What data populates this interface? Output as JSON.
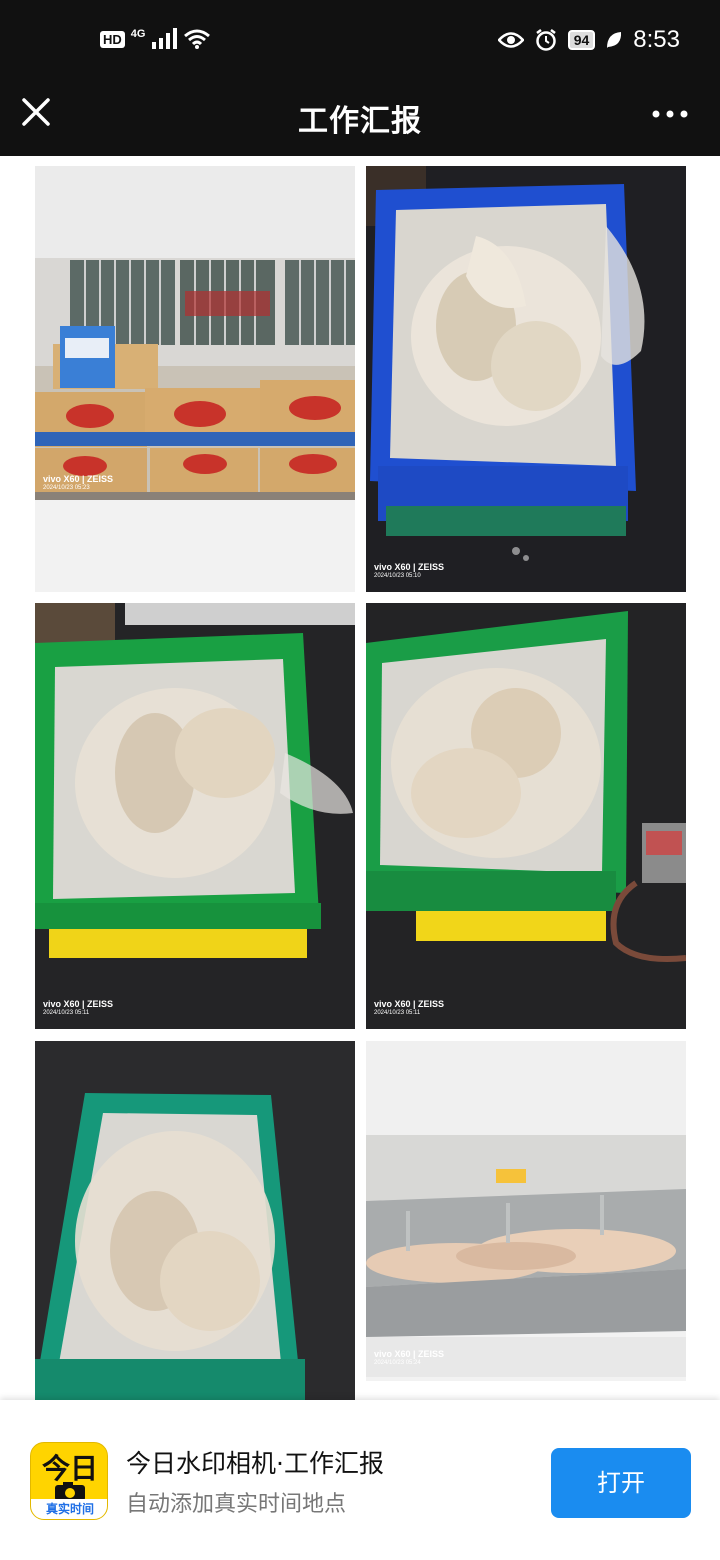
{
  "status_bar": {
    "hd": "HD",
    "network": "4G",
    "battery": "94",
    "time": "8:53",
    "icons": [
      "signal-icon",
      "wifi-icon",
      "eye-icon",
      "alarm-icon",
      "battery-icon",
      "leaf-icon"
    ]
  },
  "nav": {
    "title": "工作汇报",
    "close_icon": "close-icon",
    "more_icon": "more-icon"
  },
  "photos": [
    {
      "camera": "vivo X60 | ZEISS",
      "date": "2024/10/23 05:23",
      "subject": "boxes"
    },
    {
      "camera": "vivo X60 | ZEISS",
      "date": "2024/10/23 05:10",
      "subject": "blue-crate"
    },
    {
      "camera": "vivo X60 | ZEISS",
      "date": "2024/10/23 05:11",
      "subject": "green-crate"
    },
    {
      "camera": "vivo X60 | ZEISS",
      "date": "2024/10/23 05:11",
      "subject": "green-crate"
    },
    {
      "camera": "",
      "date": "",
      "subject": "green-crate"
    },
    {
      "camera": "vivo X60 | ZEISS",
      "date": "2024/10/23 05:24",
      "subject": "sink"
    }
  ],
  "banner": {
    "app_icon_big": "今日",
    "app_icon_small": "真实时间",
    "title": "今日水印相机·工作汇报",
    "subtitle": "自动添加真实时间地点",
    "open_label": "打开"
  },
  "colors": {
    "nav_bg": "#111111",
    "button_blue": "#1a8cf0",
    "app_icon_yellow": "#ffd400"
  }
}
